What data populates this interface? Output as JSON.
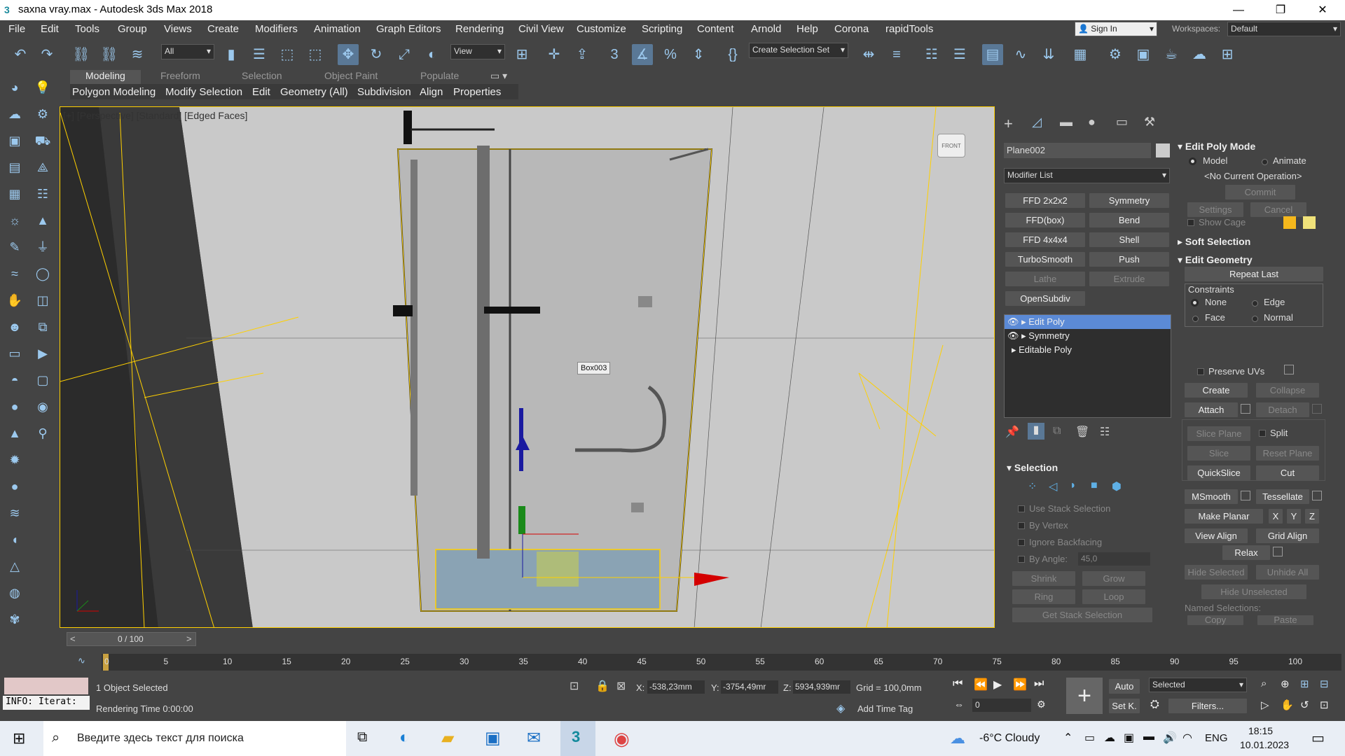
{
  "window": {
    "title": "saxna vray.max - Autodesk 3ds Max 2018",
    "minimize": "—",
    "maximize": "❐",
    "close": "✕"
  },
  "menu": [
    "File",
    "Edit",
    "Tools",
    "Group",
    "Views",
    "Create",
    "Modifiers",
    "Animation",
    "Graph Editors",
    "Rendering",
    "Civil View",
    "Customize",
    "Scripting",
    "Content",
    "Arnold",
    "Help",
    "Corona",
    "rapidTools"
  ],
  "signin": {
    "label": "Sign In"
  },
  "workspaces": {
    "label": "Workspaces:",
    "value": "Default"
  },
  "toolbar": {
    "filter": "All",
    "view": "View",
    "selection_set": "Create Selection Set"
  },
  "ribbon": {
    "tabs": [
      "Modeling",
      "Freeform",
      "Selection",
      "Object Paint",
      "Populate"
    ],
    "active": "Modeling",
    "subtabs": [
      "Polygon Modeling",
      "Modify Selection",
      "Edit",
      "Geometry (All)",
      "Subdivision",
      "Align",
      "Properties"
    ]
  },
  "viewport": {
    "label": "[+] [Perspective] [Standard] [Edged Faces]",
    "tooltip": "Box003",
    "viewcube": "FRONT"
  },
  "cmdpanel": {
    "object_name": "Plane002",
    "modifier_list": "Modifier List",
    "modifier_buttons": [
      "FFD 2x2x2",
      "Symmetry",
      "FFD(box)",
      "Bend",
      "FFD 4x4x4",
      "Shell",
      "TurboSmooth",
      "Push",
      "Lathe",
      "Extrude",
      "OpenSubdiv"
    ],
    "stack": [
      "Edit Poly",
      "Symmetry",
      "Editable Poly"
    ],
    "selection_title": "Selection",
    "use_stack": "Use Stack Selection",
    "by_vertex": "By Vertex",
    "ignore_backfacing": "Ignore Backfacing",
    "by_angle": "By Angle:",
    "angle_value": "45,0",
    "shrink": "Shrink",
    "grow": "Grow",
    "ring": "Ring",
    "loop": "Loop",
    "get_stack": "Get Stack Selection"
  },
  "rollout": {
    "edit_poly_mode": "Edit Poly Mode",
    "model": "Model",
    "animate": "Animate",
    "no_op": "<No Current Operation>",
    "commit": "Commit",
    "settings": "Settings",
    "cancel": "Cancel",
    "show_cage": "Show Cage",
    "soft_selection": "Soft Selection",
    "edit_geometry": "Edit Geometry",
    "repeat_last": "Repeat Last",
    "constraints": "Constraints",
    "none": "None",
    "edge": "Edge",
    "face": "Face",
    "normal": "Normal",
    "preserve_uvs": "Preserve UVs",
    "create": "Create",
    "collapse": "Collapse",
    "attach": "Attach",
    "detach": "Detach",
    "slice_plane": "Slice Plane",
    "split": "Split",
    "slice": "Slice",
    "reset_plane": "Reset Plane",
    "quickslice": "QuickSlice",
    "cut": "Cut",
    "msmooth": "MSmooth",
    "tessellate": "Tessellate",
    "make_planar": "Make Planar",
    "x": "X",
    "y": "Y",
    "z": "Z",
    "view_align": "View Align",
    "grid_align": "Grid Align",
    "relax": "Relax",
    "hide_selected": "Hide Selected",
    "unhide_all": "Unhide All",
    "hide_unselected": "Hide Unselected",
    "named_selections": "Named Selections:",
    "copy": "Copy",
    "paste": "Paste"
  },
  "timeline": {
    "frame": "0 / 100",
    "ticks": [
      "0",
      "5",
      "10",
      "15",
      "20",
      "25",
      "30",
      "35",
      "40",
      "45",
      "50",
      "55",
      "60",
      "65",
      "70",
      "75",
      "80",
      "85",
      "90",
      "95",
      "100"
    ]
  },
  "status": {
    "maxscript": "INFO: Iterat:",
    "objects": "1 Object Selected",
    "render_time": "Rendering Time  0:00:00",
    "x_label": "X:",
    "x": "-538,23mm",
    "y_label": "Y:",
    "y": "-3754,49mr",
    "z_label": "Z:",
    "z": "5934,939mr",
    "grid": "Grid = 100,0mm",
    "add_time_tag": "Add Time Tag",
    "auto": "Auto",
    "setk": "Set K.",
    "selected": "Selected",
    "filters": "Filters...",
    "frame_field": "0"
  },
  "taskbar": {
    "search": "Введите здесь текст для поиска",
    "weather": "-6°C  Cloudy",
    "lang": "ENG",
    "time": "18:15",
    "date": "10.01.2023"
  }
}
